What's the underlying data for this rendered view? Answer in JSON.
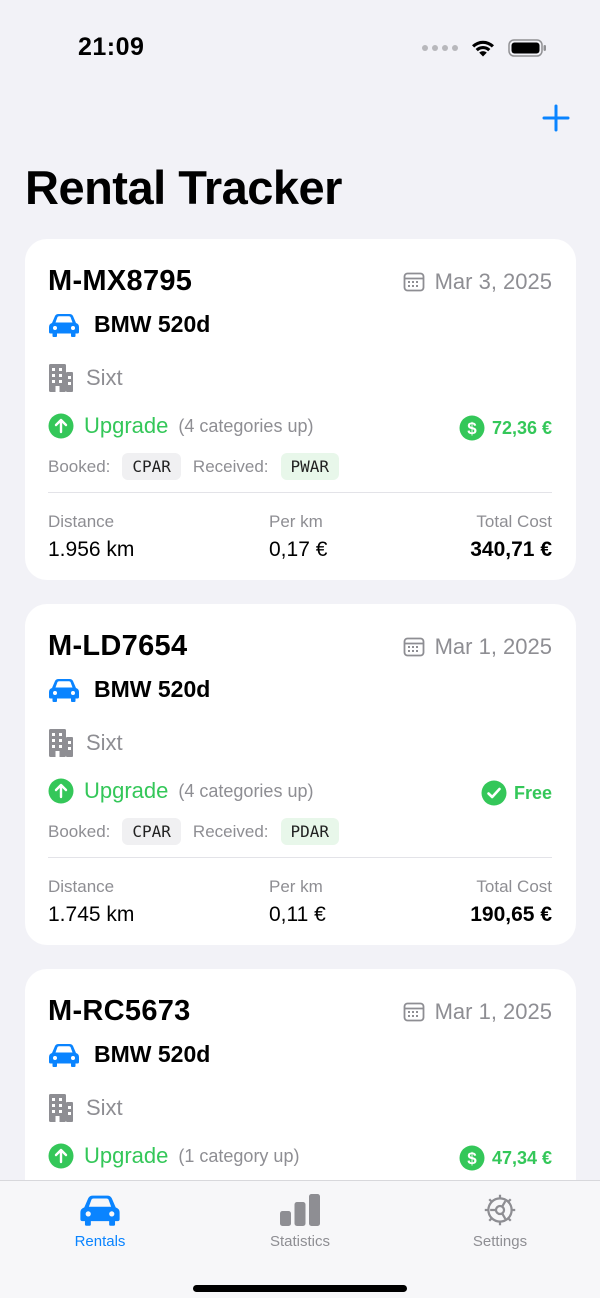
{
  "status_bar": {
    "time": "21:09",
    "icons": [
      "signal-icon",
      "wifi-icon",
      "battery-icon"
    ]
  },
  "toolbar": {
    "add_icon": "plus-icon"
  },
  "page": {
    "title": "Rental Tracker"
  },
  "labels": {
    "booked": "Booked:",
    "received": "Received:",
    "distance": "Distance",
    "per_km": "Per km",
    "total_cost": "Total Cost"
  },
  "rentals": [
    {
      "plate": "M-MX8795",
      "date": "Mar 3, 2025",
      "car": "BMW 520d",
      "company": "Sixt",
      "upgrade": "Upgrade",
      "upgrade_detail": "(4 categories up)",
      "price": "72,36 €",
      "price_icon": "dollar-circle-icon",
      "booked": "CPAR",
      "received": "PWAR",
      "distance": "1.956 km",
      "per_km": "0,17 €",
      "total": "340,71 €"
    },
    {
      "plate": "M-LD7654",
      "date": "Mar 1, 2025",
      "car": "BMW 520d",
      "company": "Sixt",
      "upgrade": "Upgrade",
      "upgrade_detail": "(4 categories up)",
      "price": "Free",
      "price_icon": "checkmark-circle-icon",
      "booked": "CPAR",
      "received": "PDAR",
      "distance": "1.745 km",
      "per_km": "0,11 €",
      "total": "190,65 €"
    },
    {
      "plate": "M-RC5673",
      "date": "Mar 1, 2025",
      "car": "BMW 520d",
      "company": "Sixt",
      "upgrade": "Upgrade",
      "upgrade_detail": "(1 category up)",
      "price": "47,34 €",
      "price_icon": "dollar-circle-icon",
      "booked": "",
      "received": "",
      "distance": "",
      "per_km": "",
      "total": ""
    }
  ],
  "tabs": [
    {
      "label": "Rentals",
      "icon": "car-icon",
      "active": true
    },
    {
      "label": "Statistics",
      "icon": "bar-chart-icon",
      "active": false
    },
    {
      "label": "Settings",
      "icon": "gear-icon",
      "active": false
    }
  ],
  "colors": {
    "accent": "#0a84ff",
    "success": "#34c759",
    "secondary_text": "#8e8e93",
    "background": "#f2f2f7"
  }
}
